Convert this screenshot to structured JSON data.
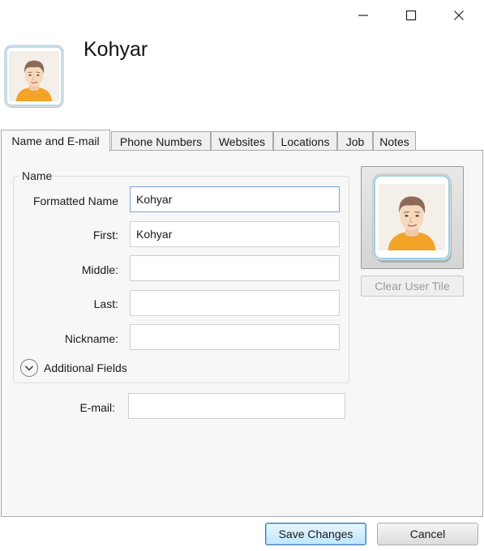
{
  "window": {
    "controls": [
      "minimize-icon",
      "maximize-icon",
      "close-icon"
    ]
  },
  "contact": {
    "display_name": "Kohyar"
  },
  "tabs": [
    {
      "label": "Name and E-mail",
      "active": true
    },
    {
      "label": "Phone Numbers",
      "active": false
    },
    {
      "label": "Websites",
      "active": false
    },
    {
      "label": "Locations",
      "active": false
    },
    {
      "label": "Job",
      "active": false
    },
    {
      "label": "Notes",
      "active": false
    }
  ],
  "name_group": {
    "legend": "Name",
    "fields": {
      "formatted": {
        "label": "Formatted Name",
        "value": "Kohyar"
      },
      "first": {
        "label": "First:",
        "value": "Kohyar"
      },
      "middle": {
        "label": "Middle:",
        "value": ""
      },
      "last": {
        "label": "Last:",
        "value": ""
      },
      "nickname": {
        "label": "Nickname:",
        "value": ""
      }
    },
    "additional_fields_label": "Additional Fields"
  },
  "email": {
    "label": "E-mail:",
    "value": ""
  },
  "user_tile": {
    "icon": "user-avatar-icon",
    "clear_label": "Clear User Tile",
    "clear_enabled": false
  },
  "actions": {
    "save_label": "Save Changes",
    "cancel_label": "Cancel"
  },
  "colors": {
    "panel_bg": "#f7f7f7",
    "focus_border": "#7da2ce",
    "default_button_border": "#3c7fb1"
  }
}
